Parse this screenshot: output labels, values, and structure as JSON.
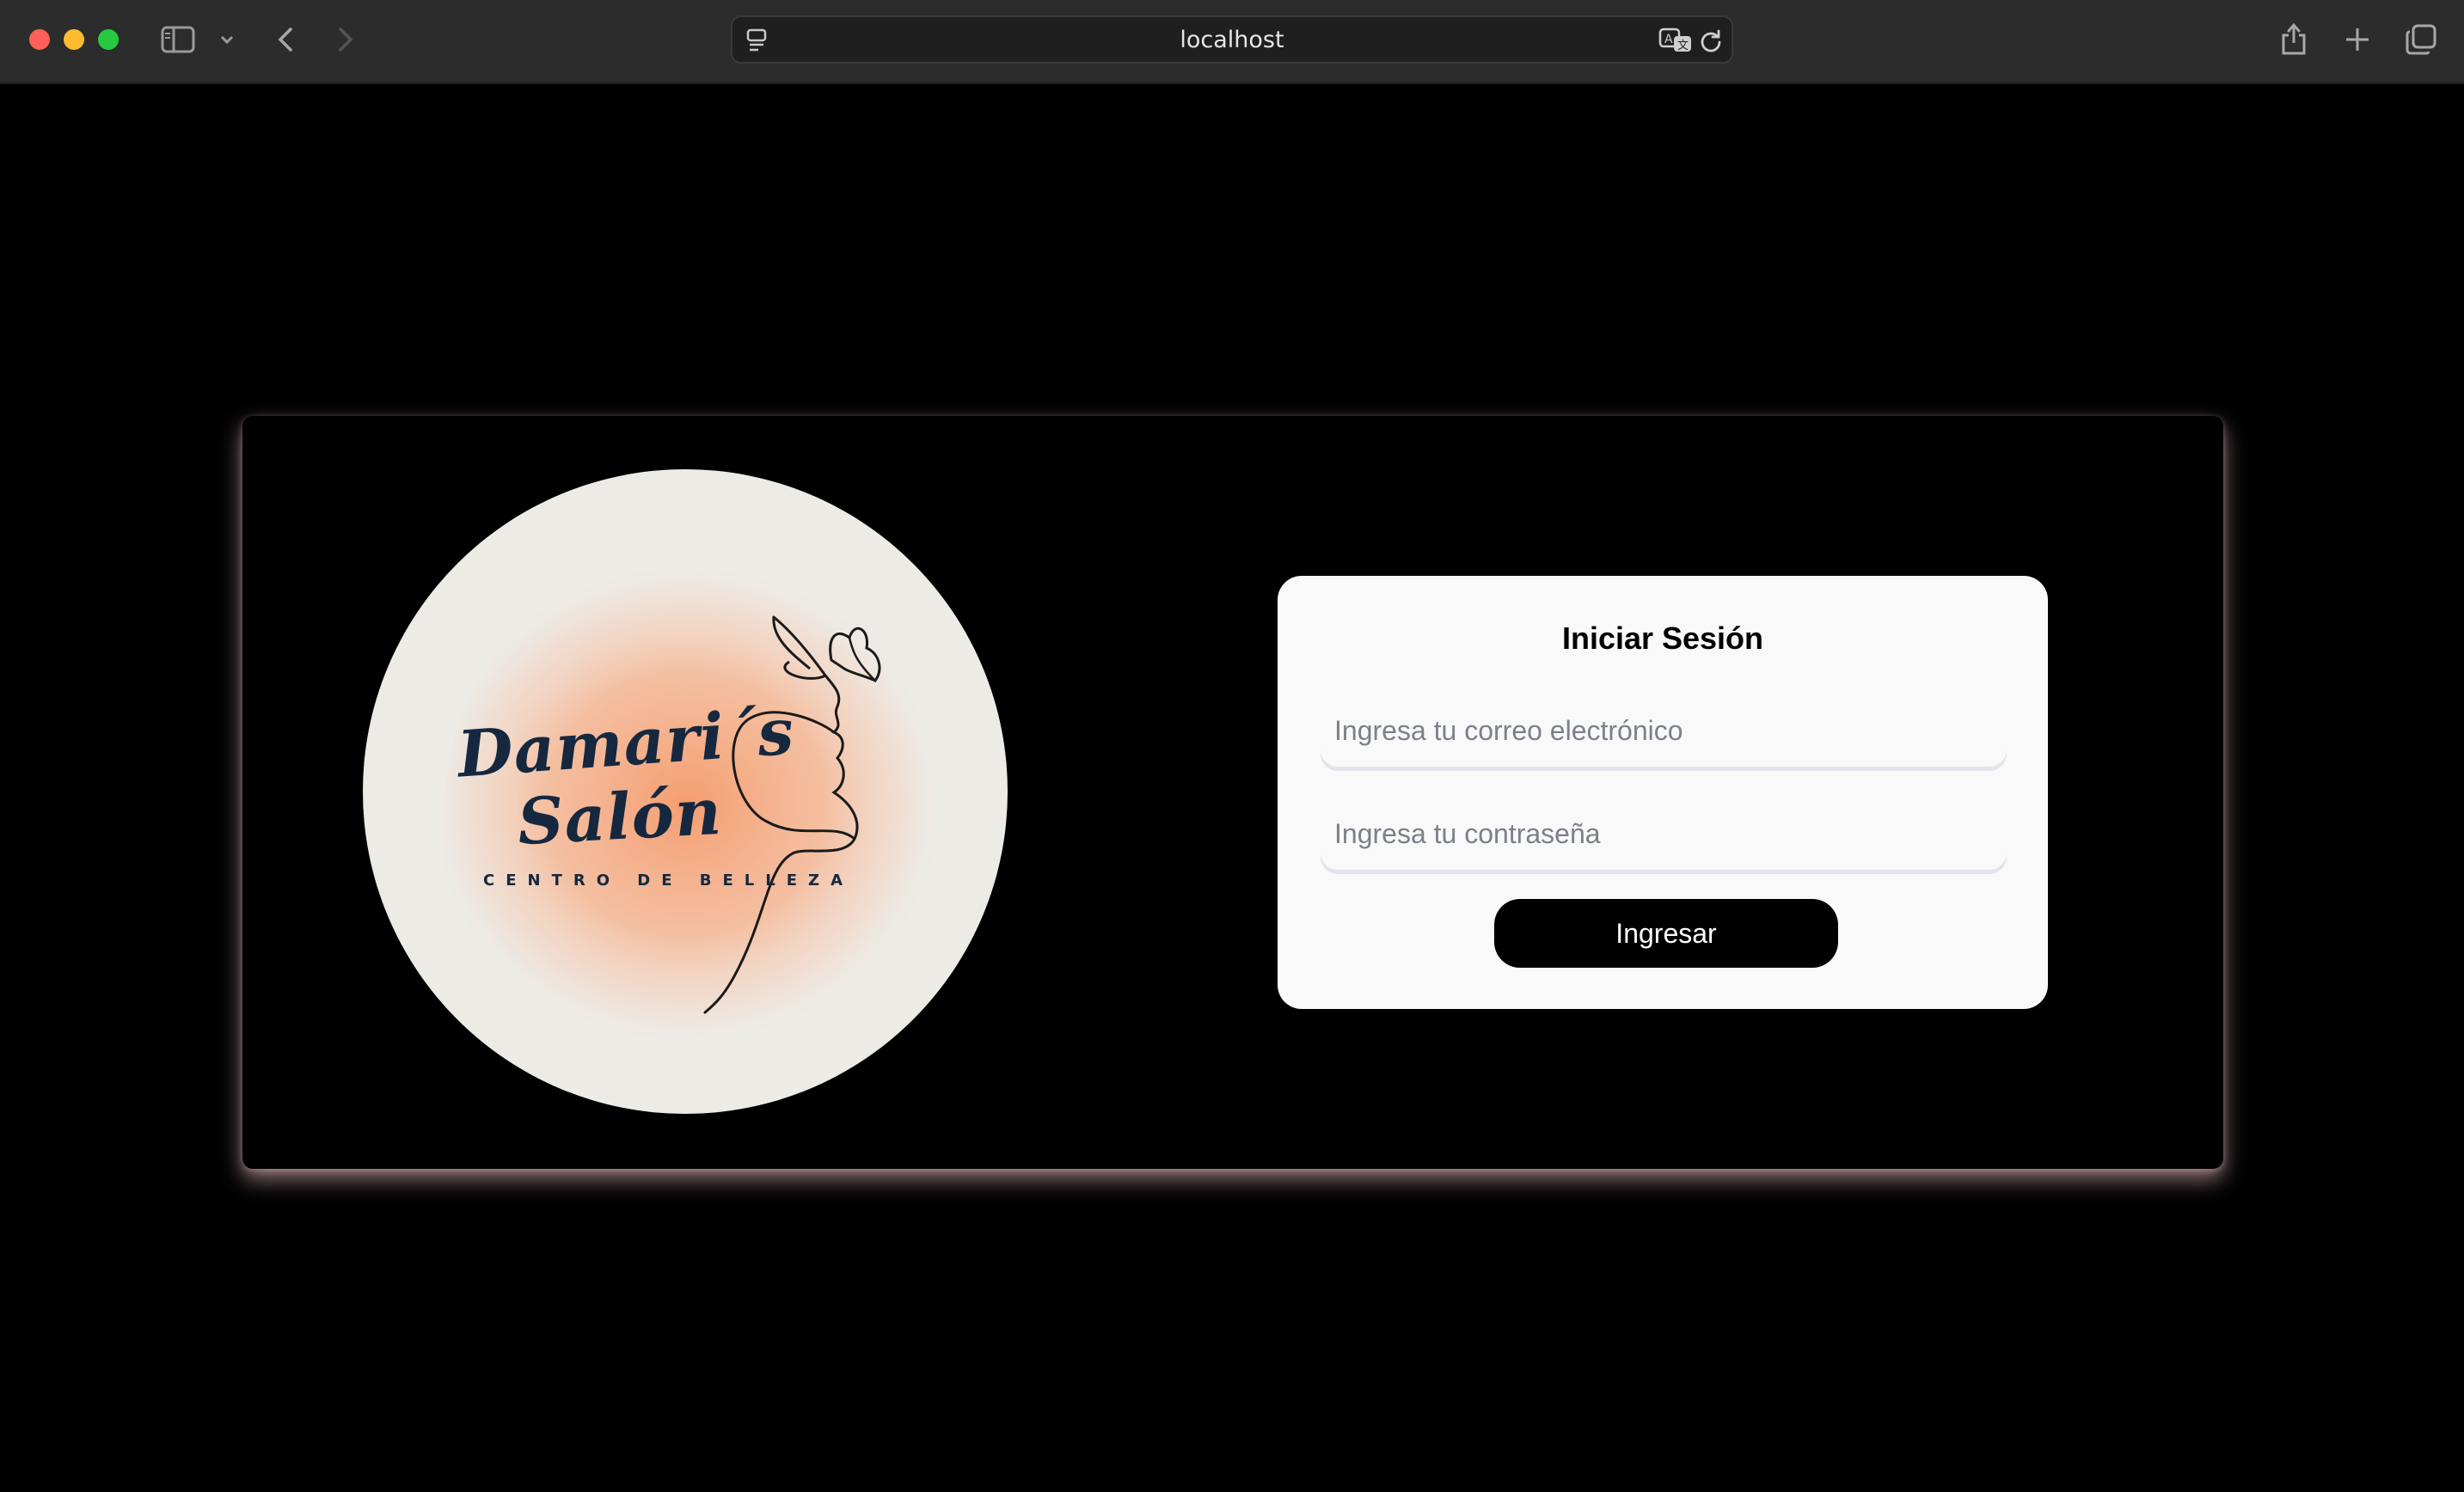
{
  "browser": {
    "url": "localhost",
    "icons": [
      "sidebar-icon",
      "chevron-down-icon",
      "back-icon",
      "forward-icon",
      "site-settings-icon",
      "translate-icon",
      "reload-icon",
      "share-icon",
      "new-tab-icon",
      "tab-overview-icon"
    ]
  },
  "logo": {
    "name_line1": "Damari´s",
    "name_line2": "Salón",
    "tagline": "CENTRO DE BELLEZA"
  },
  "login": {
    "title": "Iniciar Sesión",
    "email_placeholder": "Ingresa tu correo electrónico",
    "email_value": "",
    "password_placeholder": "Ingresa tu contraseña",
    "password_value": "",
    "submit_label": "Ingresar"
  },
  "colors": {
    "background": "#000000",
    "card": "#f9f9f9",
    "button": "#000000",
    "logo_circle": "#edebe6",
    "logo_blot": "#f6a678",
    "logo_text": "#15283f",
    "panel_glow": "#ffcdd7"
  }
}
